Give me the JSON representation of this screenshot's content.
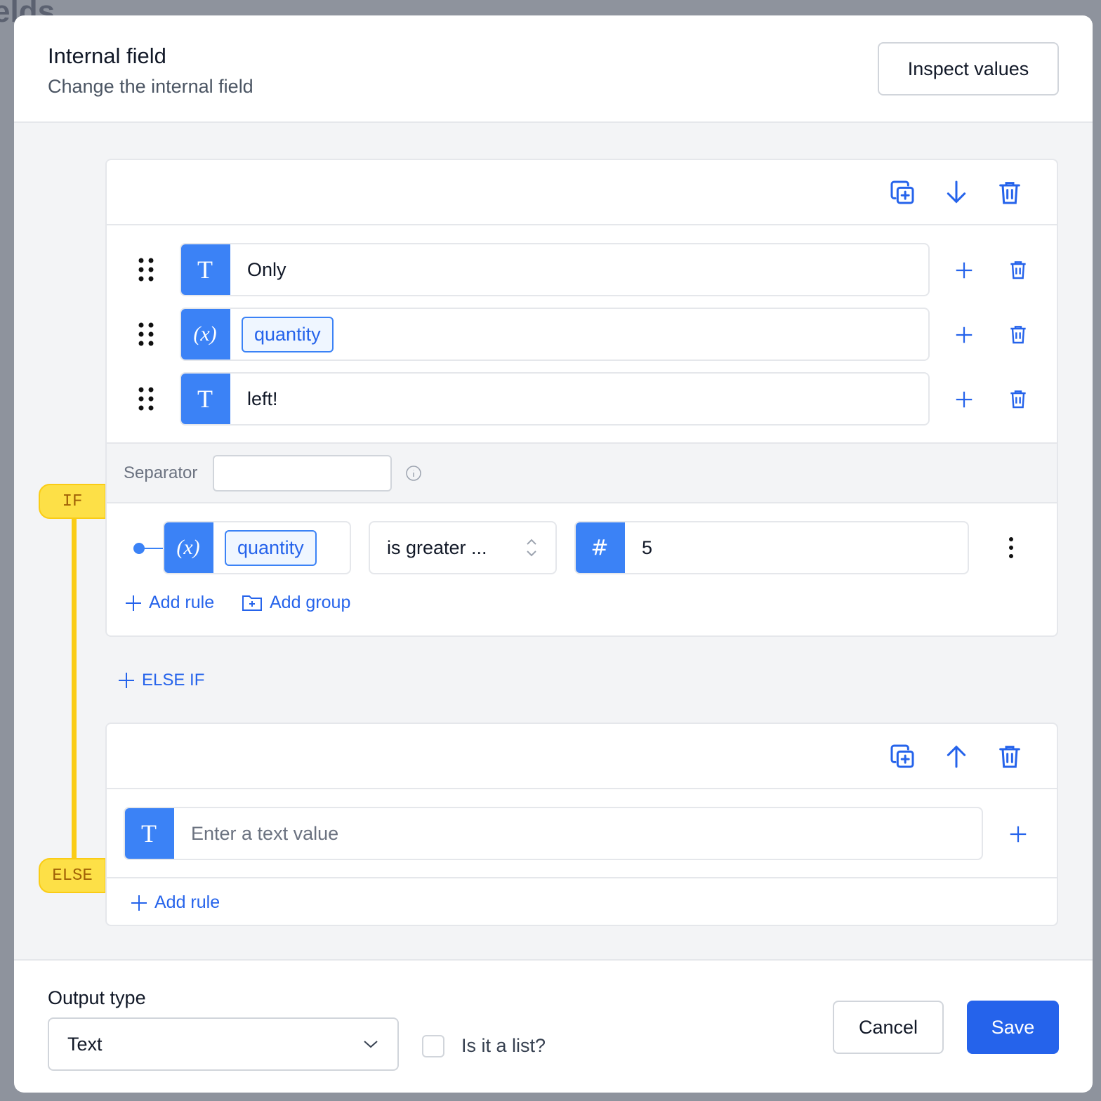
{
  "background": {
    "text": "elds"
  },
  "header": {
    "title": "Internal field",
    "subtitle": "Change the internal field",
    "inspect_label": "Inspect values"
  },
  "if_block": {
    "badge": "IF",
    "parts": [
      {
        "type": "text",
        "icon": "T",
        "value": "Only"
      },
      {
        "type": "variable",
        "icon": "(x)",
        "value": "quantity"
      },
      {
        "type": "text",
        "icon": "T",
        "value": "left!"
      }
    ],
    "separator_label": "Separator",
    "separator_value": "",
    "condition": {
      "variable_icon": "(x)",
      "variable": "quantity",
      "operator": "is greater ...",
      "value_icon": "#",
      "value": "5"
    },
    "add_rule": "Add rule",
    "add_group": "Add group"
  },
  "else_if_label": "ELSE IF",
  "else_block": {
    "badge": "ELSE",
    "placeholder": "Enter a text value",
    "icon": "T",
    "add_rule": "Add rule"
  },
  "footer": {
    "output_type_label": "Output type",
    "output_type_value": "Text",
    "is_list_label": "Is it a list?",
    "is_list_checked": false,
    "cancel": "Cancel",
    "save": "Save"
  },
  "colors": {
    "accent": "#2563eb",
    "tag": "#3b82f6",
    "badge": "#fde047"
  }
}
